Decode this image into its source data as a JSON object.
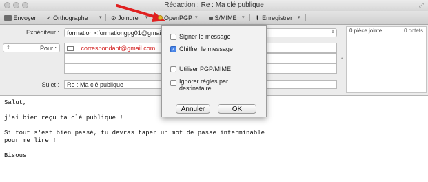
{
  "window": {
    "title": "Rédaction : Re : Ma clé publique"
  },
  "toolbar": {
    "send_label": "Envoyer",
    "spell_label": "Orthographe",
    "attach_label": "Joindre",
    "openpgp_label": "OpenPGP",
    "smime_label": "S/MIME",
    "save_label": "Enregistrer"
  },
  "headers": {
    "from_label": "Expéditeur :",
    "from_value": "formation <formationgpg01@gmail.com>",
    "to_type": "Pour :",
    "to_value": "correspondant@gmail.com",
    "subject_label": "Sujet :",
    "subject_value": "Re : Ma clé publique"
  },
  "attachments": {
    "count_label": "0 pièce jointe",
    "size_label": "0 octets"
  },
  "dialog": {
    "options": [
      {
        "label": "Signer le message",
        "checked": false
      },
      {
        "label": "Chiffrer le message",
        "checked": true
      },
      {
        "label": "Utiliser PGP/MIME",
        "checked": false
      },
      {
        "label": "Ignorer règles par destinataire",
        "checked": false
      }
    ],
    "cancel_label": "Annuler",
    "ok_label": "OK"
  },
  "body": {
    "text": "Salut,\n\nj'ai bien reçu ta clé publique !\n\nSi tout s'est bien passé, tu devras taper un mot de passe interminable\npour me lire !\n\nBisous !"
  },
  "colors": {
    "annotation_arrow": "#e02020",
    "recipient_text": "#d32020",
    "accent": "#4a86e8"
  },
  "icons": [
    "close-icon",
    "minimize-icon",
    "zoom-icon",
    "send-icon",
    "spellcheck-icon",
    "paperclip-icon",
    "lock-icon",
    "save-icon",
    "contact-card-icon",
    "red-arrow-annotation"
  ]
}
